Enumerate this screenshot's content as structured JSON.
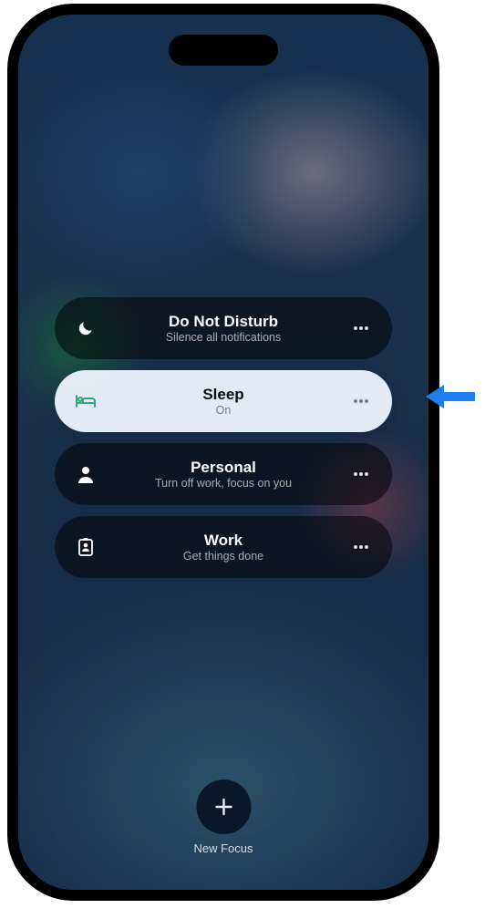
{
  "focus_modes": [
    {
      "id": "dnd",
      "title": "Do Not Disturb",
      "subtitle": "Silence all notifications",
      "active": false
    },
    {
      "id": "sleep",
      "title": "Sleep",
      "subtitle": "On",
      "active": true
    },
    {
      "id": "personal",
      "title": "Personal",
      "subtitle": "Turn off work, focus on you",
      "active": false
    },
    {
      "id": "work",
      "title": "Work",
      "subtitle": "Get things done",
      "active": false
    }
  ],
  "new_focus_label": "New Focus",
  "colors": {
    "active_row_bg": "#eef3fb",
    "inactive_row_bg": "rgba(0,0,0,0.52)",
    "arrow": "#1e7df0"
  }
}
